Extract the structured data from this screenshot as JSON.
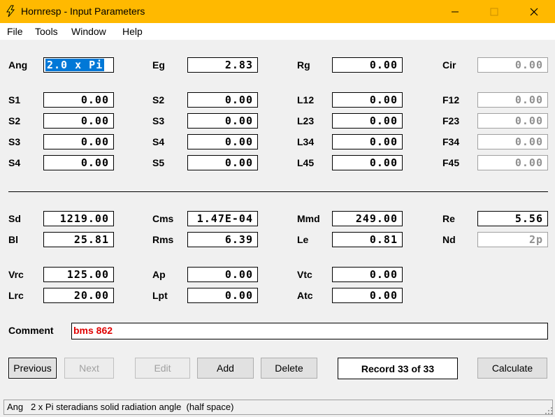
{
  "window": {
    "title": "Hornresp - Input Parameters",
    "accent": "#ffb900"
  },
  "menu": [
    "File",
    "Tools",
    "Window",
    "Help"
  ],
  "fields": {
    "ang": {
      "label": "Ang",
      "value": "2.0 x Pi"
    },
    "eg": {
      "label": "Eg",
      "value": "2.83"
    },
    "rg": {
      "label": "Rg",
      "value": "0.00"
    },
    "cir": {
      "label": "Cir",
      "value": "0.00"
    },
    "s1": {
      "label": "S1",
      "value": "0.00"
    },
    "s2a": {
      "label": "S2",
      "value": "0.00"
    },
    "s3a": {
      "label": "S3",
      "value": "0.00"
    },
    "s4a": {
      "label": "S4",
      "value": "0.00"
    },
    "s2b": {
      "label": "S2",
      "value": "0.00"
    },
    "s3b": {
      "label": "S3",
      "value": "0.00"
    },
    "s4b": {
      "label": "S4",
      "value": "0.00"
    },
    "s5": {
      "label": "S5",
      "value": "0.00"
    },
    "l12": {
      "label": "L12",
      "value": "0.00"
    },
    "l23": {
      "label": "L23",
      "value": "0.00"
    },
    "l34": {
      "label": "L34",
      "value": "0.00"
    },
    "l45": {
      "label": "L45",
      "value": "0.00"
    },
    "f12": {
      "label": "F12",
      "value": "0.00"
    },
    "f23": {
      "label": "F23",
      "value": "0.00"
    },
    "f34": {
      "label": "F34",
      "value": "0.00"
    },
    "f45": {
      "label": "F45",
      "value": "0.00"
    },
    "sd": {
      "label": "Sd",
      "value": "1219.00"
    },
    "bl": {
      "label": "Bl",
      "value": "25.81"
    },
    "cms": {
      "label": "Cms",
      "value": "1.47E-04"
    },
    "rms": {
      "label": "Rms",
      "value": "6.39"
    },
    "mmd": {
      "label": "Mmd",
      "value": "249.00"
    },
    "le": {
      "label": "Le",
      "value": "0.81"
    },
    "re": {
      "label": "Re",
      "value": "5.56"
    },
    "nd": {
      "label": "Nd",
      "value": "2p"
    },
    "vrc": {
      "label": "Vrc",
      "value": "125.00"
    },
    "lrc": {
      "label": "Lrc",
      "value": "20.00"
    },
    "ap": {
      "label": "Ap",
      "value": "0.00"
    },
    "lpt": {
      "label": "Lpt",
      "value": "0.00"
    },
    "vtc": {
      "label": "Vtc",
      "value": "0.00"
    },
    "atc": {
      "label": "Atc",
      "value": "0.00"
    }
  },
  "comment": {
    "label": "Comment",
    "value": "bms 862"
  },
  "buttons": {
    "previous": "Previous",
    "next": "Next",
    "edit": "Edit",
    "add": "Add",
    "delete": "Delete",
    "calculate": "Calculate"
  },
  "record": "Record 33 of 33",
  "status": "Ang   2 x Pi steradians solid radiation angle  (half space)"
}
